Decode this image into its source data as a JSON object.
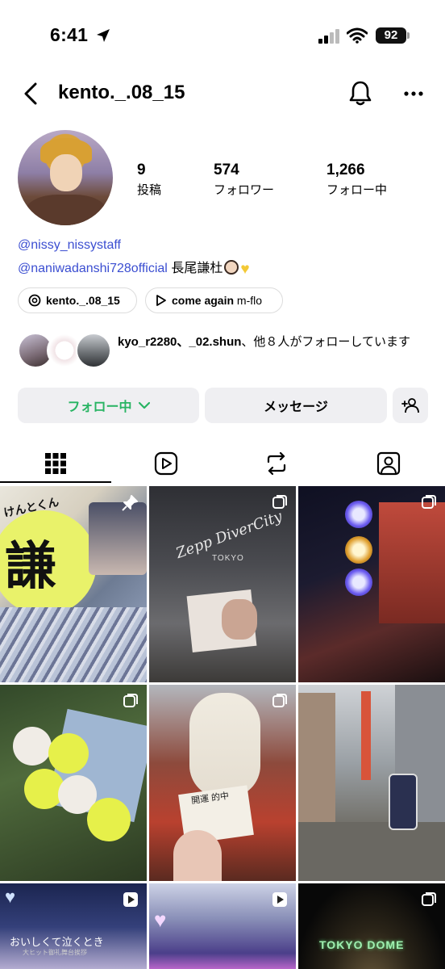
{
  "status_bar": {
    "time": "6:41",
    "battery": "92"
  },
  "header": {
    "username": "kento._.08_15"
  },
  "profile": {
    "stats": [
      {
        "value": "9",
        "label": "投稿"
      },
      {
        "value": "574",
        "label": "フォロワー"
      },
      {
        "value": "1,266",
        "label": "フォロー中"
      }
    ],
    "link_mention": "@nissy_nissystaff",
    "bio_mention": "@naniwadanshi728official",
    "bio_text": "長尾謙杜"
  },
  "chips": {
    "threads_label": "kento._.08_15",
    "music_title": "come again",
    "music_artist": "m-flo"
  },
  "followed_by": {
    "names": "kyo_r2280、_02.shun",
    "rest": "、他８人がフォローしています"
  },
  "buttons": {
    "following": "フォロー中",
    "message": "メッセージ"
  },
  "tabs": [
    "grid",
    "reels",
    "reposts",
    "tagged"
  ],
  "grid_posts": {
    "p1": "謙",
    "p1_text": "けんとくん",
    "p2_text": "Zepp DiverCity",
    "p2_sub": "TOKYO",
    "p5_text": "開運 的中",
    "p7_text": "おいしくて泣くとき",
    "p7_sub": "大ヒット御礼舞台挨拶",
    "p9_text": "TOKYO DOME"
  },
  "colors": {
    "accent_link": "#3b4ed1",
    "following_green": "#28b463",
    "button_bg": "#efeff2"
  }
}
